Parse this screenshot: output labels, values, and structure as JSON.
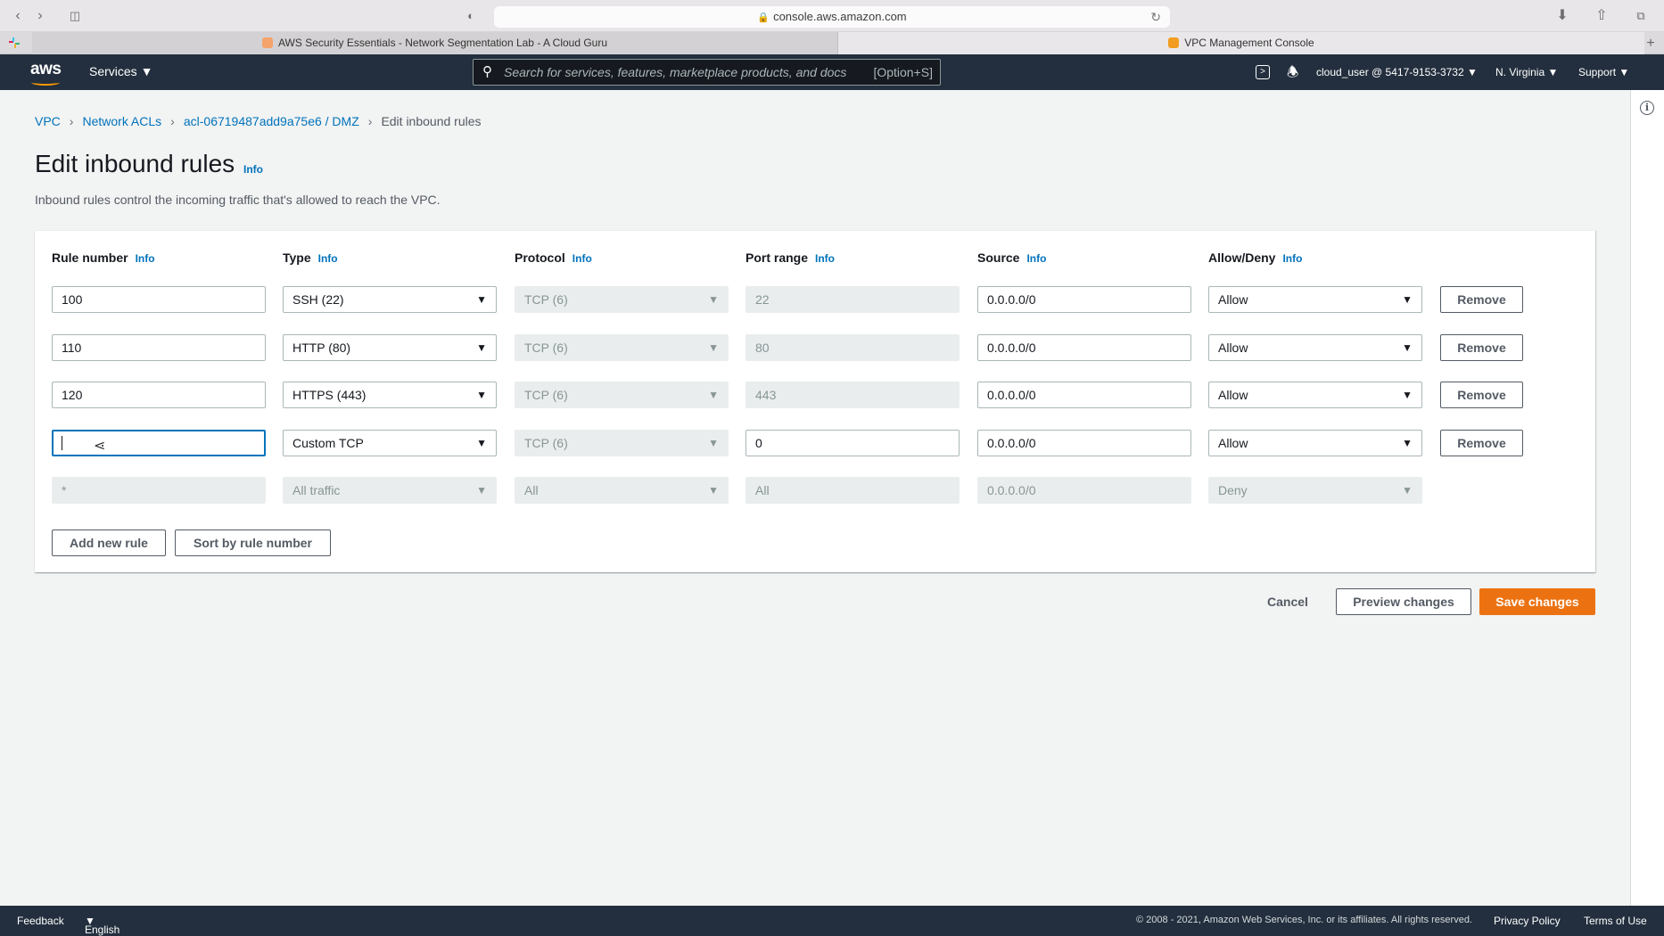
{
  "browser": {
    "url": "console.aws.amazon.com",
    "tabs": [
      {
        "title": "AWS Security Essentials - Network Segmentation Lab - A Cloud Guru",
        "favicon_color": "#f4a36b"
      },
      {
        "title": "VPC Management Console",
        "favicon_color": "#f29d1f"
      }
    ]
  },
  "header": {
    "logo": "aws",
    "services_label": "Services",
    "search_placeholder": "Search for services, features, marketplace products, and docs",
    "search_shortcut": "[Option+S]",
    "account": "cloud_user @ 5417-9153-3732",
    "region": "N. Virginia",
    "support": "Support"
  },
  "breadcrumb": {
    "vpc": "VPC",
    "nacls": "Network ACLs",
    "acl": "acl-06719487add9a75e6 / DMZ",
    "current": "Edit inbound rules"
  },
  "page": {
    "title": "Edit inbound rules",
    "info": "Info",
    "description": "Inbound rules control the incoming traffic that's allowed to reach the VPC."
  },
  "columns": {
    "rule_number": "Rule number",
    "type": "Type",
    "protocol": "Protocol",
    "port_range": "Port range",
    "source": "Source",
    "allow_deny": "Allow/Deny",
    "info": "Info"
  },
  "rules": [
    {
      "number": "100",
      "type": "SSH (22)",
      "protocol": "TCP (6)",
      "port": "22",
      "source": "0.0.0.0/0",
      "action": "Allow",
      "remove": "Remove"
    },
    {
      "number": "110",
      "type": "HTTP (80)",
      "protocol": "TCP (6)",
      "port": "80",
      "source": "0.0.0.0/0",
      "action": "Allow",
      "remove": "Remove"
    },
    {
      "number": "120",
      "type": "HTTPS (443)",
      "protocol": "TCP (6)",
      "port": "443",
      "source": "0.0.0.0/0",
      "action": "Allow",
      "remove": "Remove"
    },
    {
      "number": "",
      "type": "Custom TCP",
      "protocol": "TCP (6)",
      "port": "0",
      "source": "0.0.0.0/0",
      "action": "Allow",
      "remove": "Remove"
    }
  ],
  "default_rule": {
    "number": "*",
    "type": "All traffic",
    "protocol": "All",
    "port": "All",
    "source": "0.0.0.0/0",
    "action": "Deny"
  },
  "actions": {
    "add_rule": "Add new rule",
    "sort": "Sort by rule number",
    "cancel": "Cancel",
    "preview": "Preview changes",
    "save": "Save changes"
  },
  "footer": {
    "feedback": "Feedback",
    "language": "English (US)",
    "copyright": "© 2008 - 2021, Amazon Web Services, Inc. or its affiliates. All rights reserved.",
    "privacy": "Privacy Policy",
    "terms": "Terms of Use"
  },
  "colors": {
    "nav_bg": "#232f3e",
    "link": "#0073bb",
    "primary": "#ec7211"
  }
}
